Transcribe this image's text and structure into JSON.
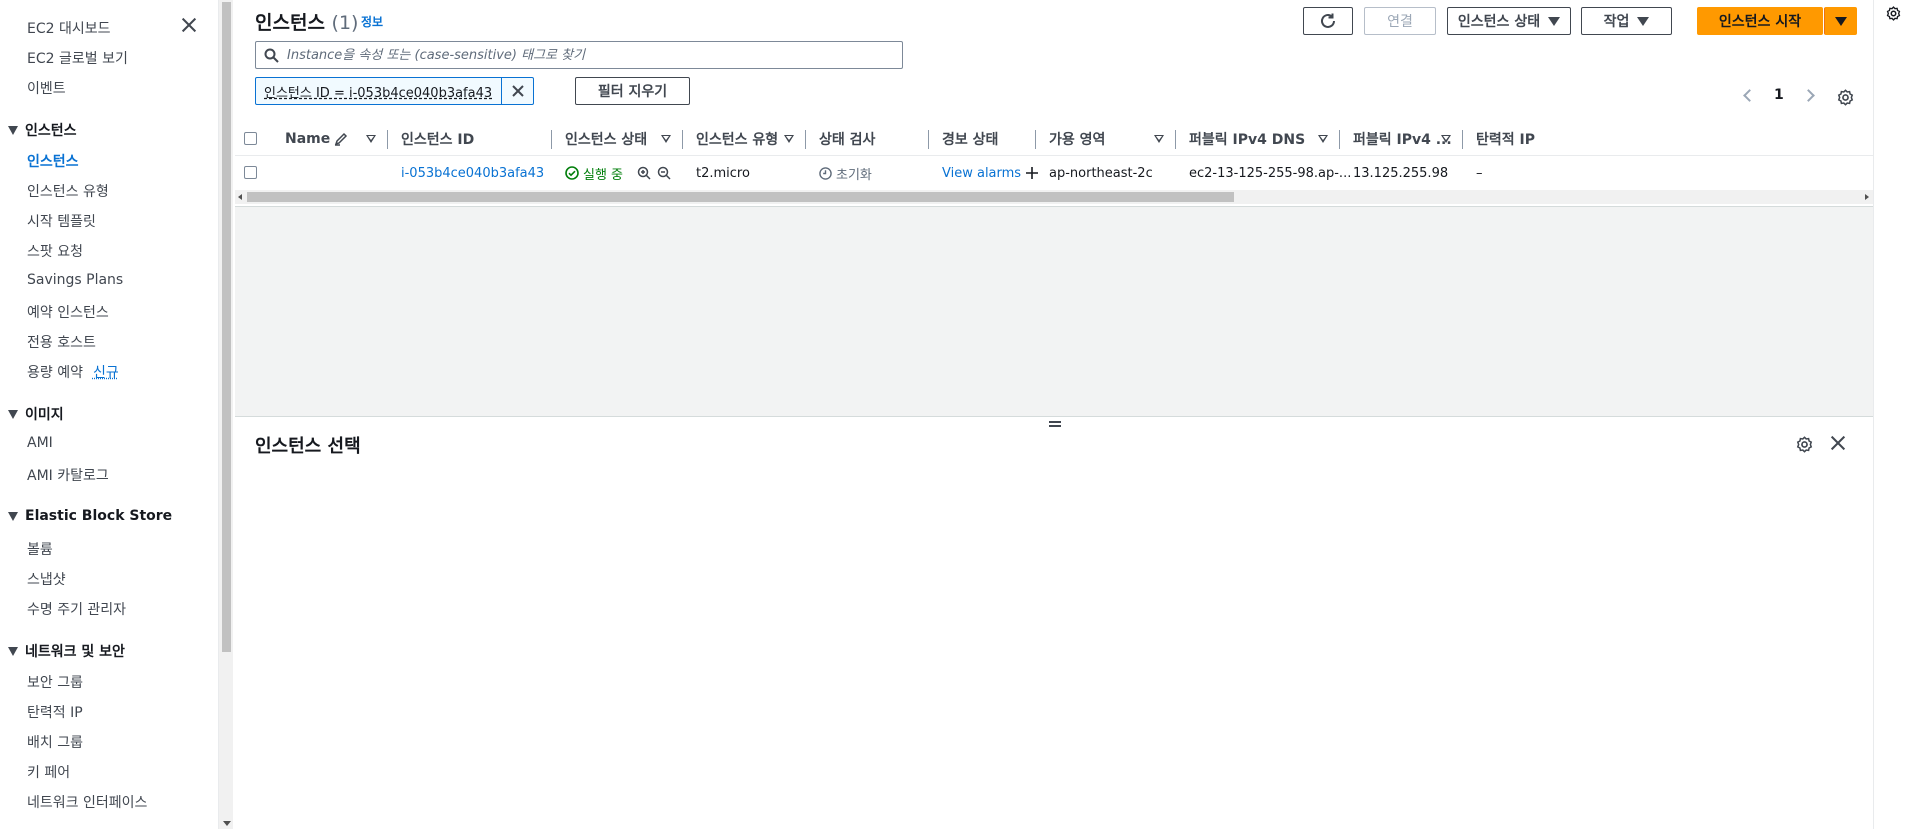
{
  "sidebar": {
    "top_items": [
      {
        "label": "EC2 대시보드"
      },
      {
        "label": "EC2 글로벌 보기"
      },
      {
        "label": "이벤트"
      }
    ],
    "sections": [
      {
        "title": "인스턴스",
        "items": [
          {
            "label": "인스턴스"
          },
          {
            "label": "인스턴스 유형"
          },
          {
            "label": "시작 템플릿"
          },
          {
            "label": "스팟 요청"
          },
          {
            "label": "Savings Plans"
          },
          {
            "label": "예약 인스턴스"
          },
          {
            "label": "전용 호스트"
          },
          {
            "label": "용량 예약"
          }
        ]
      },
      {
        "title": "이미지",
        "items": [
          {
            "label": "AMI"
          },
          {
            "label": "AMI 카탈로그"
          }
        ]
      },
      {
        "title": "Elastic Block Store",
        "items": [
          {
            "label": "볼륨"
          },
          {
            "label": "스냅샷"
          },
          {
            "label": "수명 주기 관리자"
          }
        ]
      },
      {
        "title": "네트워크 및 보안",
        "items": [
          {
            "label": "보안 그룹"
          },
          {
            "label": "탄력적 IP"
          },
          {
            "label": "배치 그룹"
          },
          {
            "label": "키 페어"
          },
          {
            "label": "네트워크 인터페이스"
          }
        ]
      }
    ],
    "new_badge": "신규",
    "active_item": "인스턴스"
  },
  "header": {
    "title": "인스턴스",
    "count": "(1)",
    "info_link": "정보",
    "buttons": {
      "connect": "연결",
      "instance_state": "인스턴스 상태",
      "actions": "작업",
      "launch": "인스턴스 시작"
    }
  },
  "search": {
    "placeholder": "Instance을 속성 또는 (case-sensitive) 태그로 찾기"
  },
  "filter": {
    "token": "인스턴스 ID = i-053b4ce040b3afa43",
    "clear_label": "필터 지우기"
  },
  "pagination": {
    "current_page": "1"
  },
  "table": {
    "columns": [
      {
        "label": "Name"
      },
      {
        "label": "인스턴스 ID"
      },
      {
        "label": "인스턴스 상태"
      },
      {
        "label": "인스턴스 유형"
      },
      {
        "label": "상태 검사"
      },
      {
        "label": "경보 상태"
      },
      {
        "label": "가용 영역"
      },
      {
        "label": "퍼블릭 IPv4 DNS"
      },
      {
        "label": "퍼블릭 IPv4 ..."
      },
      {
        "label": "탄력적 IP"
      }
    ],
    "rows": [
      {
        "name": "",
        "instance_id": "i-053b4ce040b3afa43",
        "state": "실행 중",
        "type": "t2.micro",
        "status_check": "초기화",
        "alarm": "View alarms",
        "az": "ap-northeast-2c",
        "public_dns": "ec2-13-125-255-98.ap-...",
        "public_ipv4": "13.125.255.98",
        "elastic_ip": "–"
      }
    ]
  },
  "detail_panel": {
    "title": "인스턴스 선택"
  },
  "colors": {
    "accent_link": "#0972d3",
    "primary_button": "#ff9900",
    "running_green": "#037f0c"
  },
  "icons": {
    "refresh": "refresh-icon",
    "search": "search-icon",
    "settings": "gear-icon",
    "close": "close-icon"
  }
}
